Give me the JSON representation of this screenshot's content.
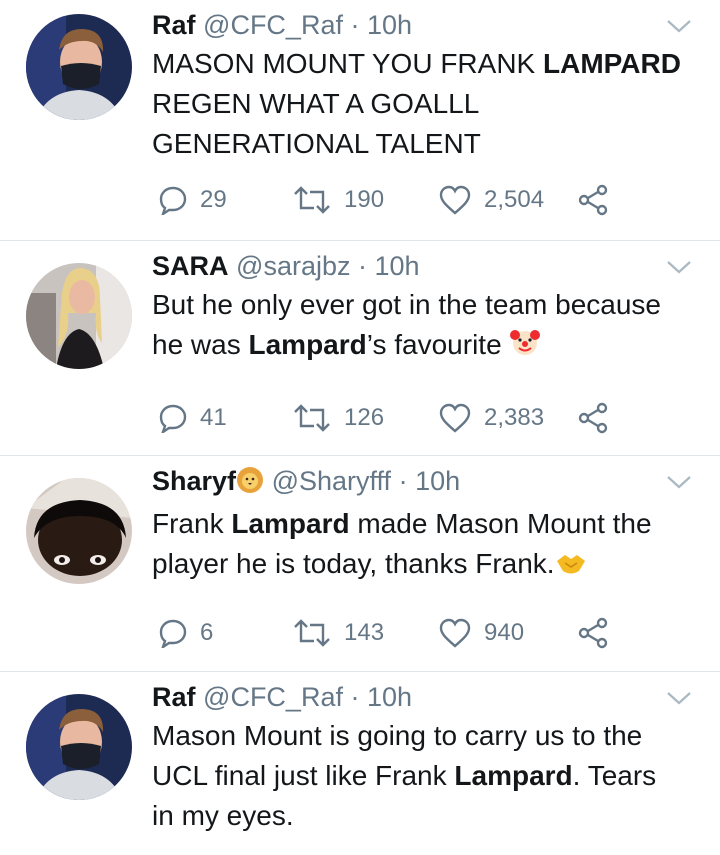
{
  "tweets": [
    {
      "name": "Raf",
      "name_emoji": "",
      "handle": "@CFC_Raf",
      "dot": "·",
      "time": "10h",
      "text": [
        {
          "t": "MASON MOUNT YOU FRANK ",
          "b": false
        },
        {
          "t": "LAMPARD",
          "b": true
        },
        {
          "t": "\nREGEN WHAT A GOALLL\nGENERATIONAL TALENT",
          "b": false
        }
      ],
      "replies": "29",
      "retweets": "190",
      "likes": "2,504",
      "avatar": "man-with-black-face-mask"
    },
    {
      "name": "SARA",
      "name_emoji": "",
      "handle": "@sarajbz",
      "dot": "·",
      "time": "10h",
      "text": [
        {
          "t": "But he only ever got in the team because\nhe was ",
          "b": false
        },
        {
          "t": "Lampard",
          "b": true
        },
        {
          "t": "’s favourite ",
          "b": false
        }
      ],
      "trailing_emoji": "clown-face-emoji",
      "replies": "41",
      "retweets": "126",
      "likes": "2,383",
      "avatar": "blonde-woman-selfie"
    },
    {
      "name": "Sharyf",
      "name_emoji": "lion-face-emoji",
      "handle": "@Sharyfff",
      "dot": "·",
      "time": "10h",
      "text": [
        {
          "t": "Frank ",
          "b": false
        },
        {
          "t": "Lampard",
          "b": true
        },
        {
          "t": " made Mason Mount the\nplayer he is today, thanks Frank.",
          "b": false
        }
      ],
      "trailing_emoji": "handshake-emoji",
      "replies": "6",
      "retweets": "143",
      "likes": "940",
      "avatar": "man-face-close-up"
    },
    {
      "name": "Raf",
      "name_emoji": "",
      "handle": "@CFC_Raf",
      "dot": "·",
      "time": "10h",
      "text": [
        {
          "t": "Mason Mount is going to carry us to the\nUCL final just like Frank ",
          "b": false
        },
        {
          "t": "Lampard",
          "b": true
        },
        {
          "t": ". Tears\nin my eyes.",
          "b": false
        }
      ],
      "avatar": "man-with-black-face-mask"
    }
  ],
  "colors": {
    "icon_gray": "#657786",
    "divider": "#e1e6ea",
    "text": "#14171a"
  }
}
